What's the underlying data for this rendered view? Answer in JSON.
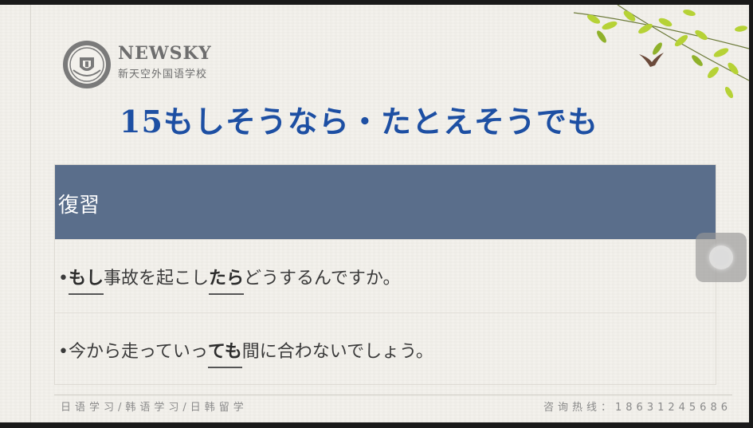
{
  "brand": {
    "name_en": "NEWSKY",
    "name_cn": "新天空外国语学校"
  },
  "slide": {
    "title": "15もしそうなら・たとえそうでも",
    "table": {
      "header": "復習",
      "rows": [
        {
          "bullet": "•",
          "parts": [
            "もし",
            "事故を起こし",
            "たら",
            "どうするんですか。"
          ]
        },
        {
          "bullet": "•",
          "parts": [
            "今から走っていっ",
            "ても",
            "間に合わないでしょう。"
          ]
        }
      ]
    }
  },
  "footer": {
    "left": "日语学习/韩语学习/日韩留学",
    "right": "咨询热线：18631245686"
  },
  "colors": {
    "title": "#1d4fa3",
    "header_bg": "#5a6e8b",
    "slide_bg": "#f3f1ec"
  },
  "icons": [
    "school-seal-logo-icon",
    "leaves-decoration-icon",
    "swallow-bird-icon",
    "floating-assistive-button-icon"
  ]
}
